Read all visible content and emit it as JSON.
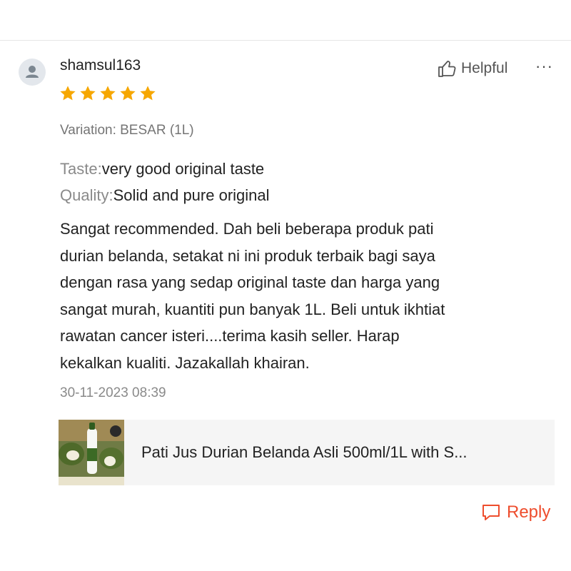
{
  "review": {
    "username": "shamsul163",
    "rating": 5,
    "rating_max": 5,
    "helpful_label": "Helpful",
    "more_label": "···",
    "variation": "Variation: BESAR (1L)",
    "attributes": [
      {
        "key": "Taste:",
        "value": "very good original taste"
      },
      {
        "key": "Quality:",
        "value": "Solid and pure original"
      }
    ],
    "body_lines": [
      "Sangat recommended. Dah beli beberapa produk pati",
      "durian belanda, setakat ni ini produk terbaik bagi saya",
      "dengan rasa yang sedap original taste dan harga yang",
      "sangat murah, kuantiti pun banyak 1L. Beli untuk ikhtiat",
      "rawatan cancer isteri....terima kasih seller. Harap",
      "kekalkan kualiti. Jazakallah khairan."
    ],
    "timestamp": "30-11-2023 08:39"
  },
  "product": {
    "title": "Pati Jus Durian Belanda Asli 500ml/1L with S..."
  },
  "actions": {
    "reply_label": "Reply"
  },
  "icons": {
    "avatar": "user-avatar-icon",
    "helpful": "thumbs-up-icon",
    "star": "star-icon",
    "reply": "chat-bubble-icon"
  },
  "colors": {
    "star": "#f6a700",
    "accent": "#ee4d2d",
    "card_bg": "#f5f5f5",
    "muted_text": "#8a8a8a"
  }
}
